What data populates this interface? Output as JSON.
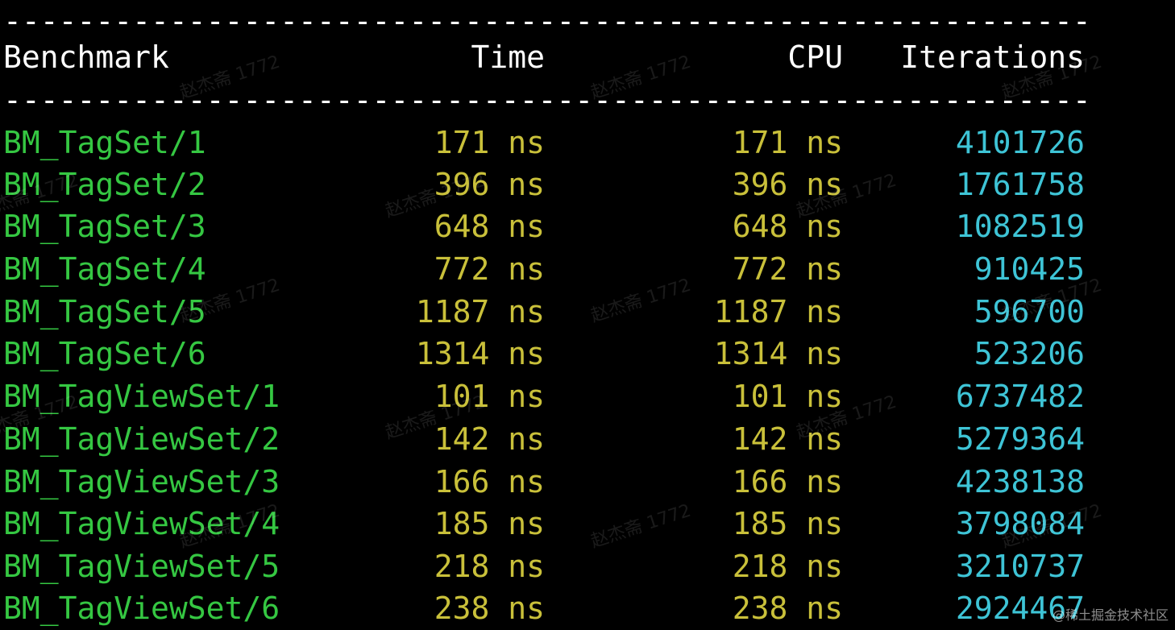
{
  "separator": "-----------------------------------------------------------",
  "header": {
    "benchmark": "Benchmark",
    "time": "Time",
    "cpu": "CPU",
    "iterations": "Iterations"
  },
  "rows": [
    {
      "name": "BM_TagSet/1",
      "time": "171 ns",
      "cpu": "171 ns",
      "iterations": "4101726"
    },
    {
      "name": "BM_TagSet/2",
      "time": "396 ns",
      "cpu": "396 ns",
      "iterations": "1761758"
    },
    {
      "name": "BM_TagSet/3",
      "time": "648 ns",
      "cpu": "648 ns",
      "iterations": "1082519"
    },
    {
      "name": "BM_TagSet/4",
      "time": "772 ns",
      "cpu": "772 ns",
      "iterations": "910425"
    },
    {
      "name": "BM_TagSet/5",
      "time": "1187 ns",
      "cpu": "1187 ns",
      "iterations": "596700"
    },
    {
      "name": "BM_TagSet/6",
      "time": "1314 ns",
      "cpu": "1314 ns",
      "iterations": "523206"
    },
    {
      "name": "BM_TagViewSet/1",
      "time": "101 ns",
      "cpu": "101 ns",
      "iterations": "6737482"
    },
    {
      "name": "BM_TagViewSet/2",
      "time": "142 ns",
      "cpu": "142 ns",
      "iterations": "5279364"
    },
    {
      "name": "BM_TagViewSet/3",
      "time": "166 ns",
      "cpu": "166 ns",
      "iterations": "4238138"
    },
    {
      "name": "BM_TagViewSet/4",
      "time": "185 ns",
      "cpu": "185 ns",
      "iterations": "3798084"
    },
    {
      "name": "BM_TagViewSet/5",
      "time": "218 ns",
      "cpu": "218 ns",
      "iterations": "3210737"
    },
    {
      "name": "BM_TagViewSet/6",
      "time": "238 ns",
      "cpu": "238 ns",
      "iterations": "2924467"
    }
  ],
  "watermark_text": "赵杰斋 1772",
  "corner_mark": "@稀土掘金技术社区",
  "colors": {
    "background": "#000000",
    "header": "#ffffff",
    "benchmark_name": "#35c742",
    "timing": "#c9c03a",
    "iterations": "#3ec4d6"
  }
}
